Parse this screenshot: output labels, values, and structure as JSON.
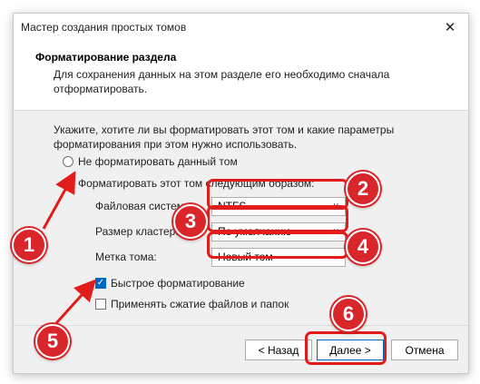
{
  "window": {
    "title": "Мастер создания простых томов",
    "close_glyph": "✕"
  },
  "header": {
    "title": "Форматирование раздела",
    "description": "Для сохранения данных на этом разделе его необходимо сначала отформатировать."
  },
  "prompt": "Укажите, хотите ли вы форматировать этот том и какие параметры форматирования при этом нужно использовать.",
  "options": {
    "no_format": {
      "label": "Не форматировать данный том",
      "selected": false
    },
    "format": {
      "label": "Форматировать этот том следующим образом:",
      "selected": true
    }
  },
  "fields": {
    "filesystem": {
      "label": "Файловая система:",
      "value": "NTFS"
    },
    "cluster": {
      "label": "Размер кластера:",
      "value": "По умолчанию"
    },
    "volume_label": {
      "label": "Метка тома:",
      "value": "Новый том"
    }
  },
  "checks": {
    "quick": {
      "label": "Быстрое форматирование",
      "checked": true
    },
    "compress": {
      "label": "Применять сжатие файлов и папок",
      "checked": false
    }
  },
  "buttons": {
    "back": "< Назад",
    "next": "Далее >",
    "cancel": "Отмена"
  },
  "badges": [
    "1",
    "2",
    "3",
    "4",
    "5",
    "6"
  ],
  "colors": {
    "accent": "#0067c0",
    "highlight": "#e21b1b"
  }
}
